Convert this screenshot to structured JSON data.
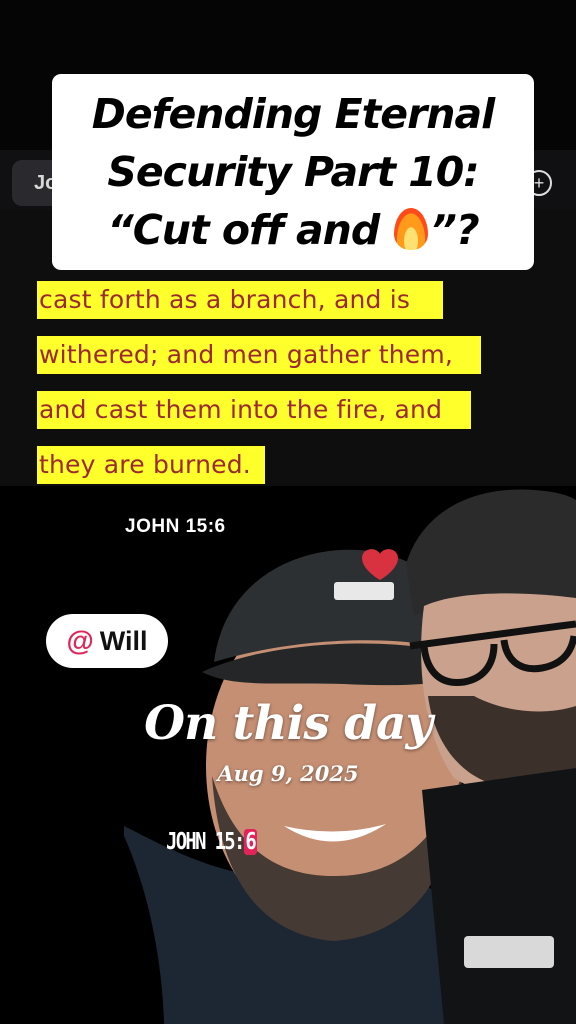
{
  "title": {
    "lines": [
      "Defending Eternal",
      "Security Part 10:",
      "“Cut off and ",
      "”?"
    ],
    "emoji": "fire-emoji"
  },
  "search": {
    "partial_text": "Jo"
  },
  "verse": {
    "lines": [
      "cast forth as a branch, and is",
      "withered; and men gather them,",
      "and cast them into the fire, and",
      "they are burned."
    ],
    "highlight_color": "#ffff2b",
    "text_color": "#9a2a30"
  },
  "reference_top": "JOHN 15:6",
  "mention": {
    "at": "@",
    "name": "Will"
  },
  "memory": {
    "title": "On this day",
    "date": "Aug 9, 2025"
  },
  "reference_bottom": {
    "main": "JOHN 15:",
    "highlight": "6"
  }
}
